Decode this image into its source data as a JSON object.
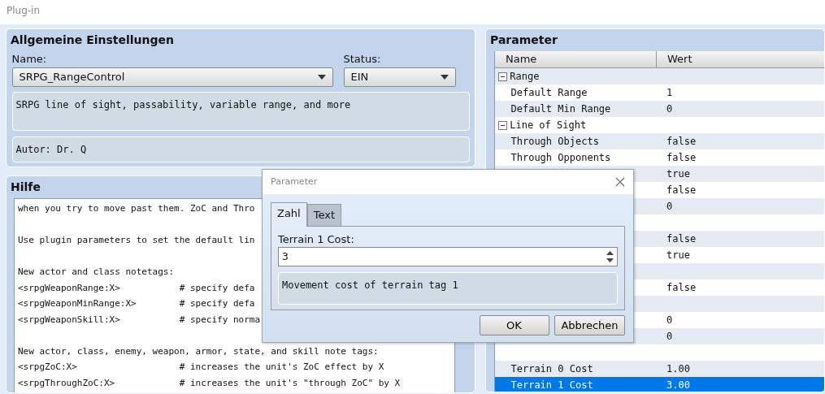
{
  "window": {
    "title": "Plug-in"
  },
  "general": {
    "title": "Allgemeine Einstellungen",
    "name_label": "Name:",
    "name_value": "SRPG_RangeControl",
    "status_label": "Status:",
    "status_value": "EIN",
    "description": "SRPG line of sight, passability, variable range, and more",
    "author": "Autor: Dr. Q"
  },
  "help": {
    "title": "Hilfe",
    "blocks": [
      [
        "when you try to move past them. ZoC and Thro"
      ],
      [
        "Use plugin parameters to set the default lin"
      ],
      [
        "New actor and class notetags:",
        "<srpgWeaponRange:X>           # specify defa",
        "<srpgWeaponMinRange:X>        # specify defa",
        "<srpgWeaponSkill:X>           # specify norma"
      ],
      [
        "New actor, class, enemy, weapon, armor, state, and skill note tags:",
        "<srpgZoC:X>                   # increases the unit's ZoC effect by X",
        "<srpgThroughZoC:X>            # increases the unit's \"through ZoC\" by X"
      ]
    ]
  },
  "parameters": {
    "title": "Parameter",
    "columns": [
      "Name",
      "Wert"
    ],
    "groups": [
      {
        "name": "Range",
        "expanded": true,
        "children": [
          {
            "name": "Default Range",
            "value": "1",
            "selected": false
          },
          {
            "name": "Default Min Range",
            "value": "0",
            "selected": false
          }
        ]
      },
      {
        "name": "Line of Sight",
        "expanded": true,
        "children": [
          {
            "name": "Through Objects",
            "value": "false",
            "selected": false
          },
          {
            "name": "Through Opponents",
            "value": "false",
            "selected": false
          },
          {
            "value": "true",
            "selected": false
          },
          {
            "value": "false",
            "selected": false
          },
          {
            "value": "0",
            "selected": false
          }
        ]
      },
      {
        "children": [
          {
            "value": "false",
            "selected": false
          },
          {
            "value": "true",
            "selected": false
          }
        ]
      },
      {
        "children": [
          {
            "value": "false",
            "selected": false
          }
        ]
      },
      {
        "children": [
          {
            "value": "0",
            "selected": false
          },
          {
            "value": "0",
            "selected": false
          }
        ]
      },
      {
        "children": [
          {
            "name": "Terrain 0 Cost",
            "value": "1.00",
            "selected": false
          },
          {
            "name": "Terrain 1 Cost",
            "value": "3.00",
            "selected": true
          }
        ]
      }
    ]
  },
  "dialog": {
    "title": "Parameter",
    "tabs": [
      {
        "label": "Zahl",
        "selected": true
      },
      {
        "label": "Text",
        "selected": false
      }
    ],
    "field_label": "Terrain 1 Cost:",
    "field_value": "3",
    "description": "Movement cost of terrain tag 1",
    "buttons": [
      "OK",
      "Abbrechen"
    ]
  }
}
